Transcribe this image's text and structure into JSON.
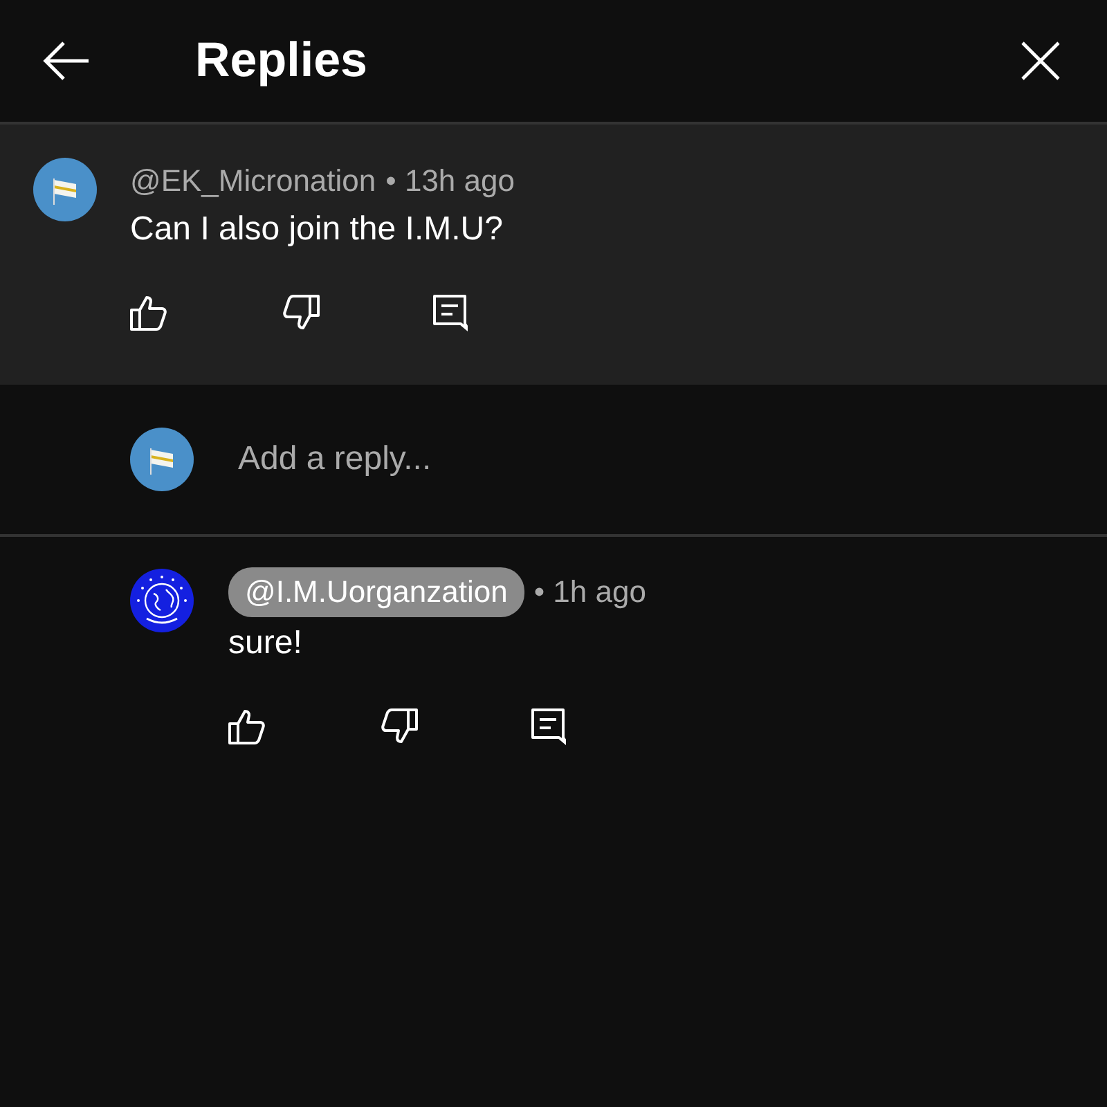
{
  "header": {
    "title": "Replies"
  },
  "parent_comment": {
    "author": "@EK_Micronation",
    "author_highlighted": false,
    "separator": "•",
    "time": "13h ago",
    "text": "Can I also join the I.M.U?",
    "avatar": {
      "kind": "flag"
    }
  },
  "reply_box": {
    "avatar": {
      "kind": "flag"
    },
    "placeholder": "Add a reply..."
  },
  "replies": [
    {
      "author": "@I.M.Uorganzation",
      "author_highlighted": true,
      "separator": "•",
      "time": "1h ago",
      "text": "sure!",
      "avatar": {
        "kind": "globe"
      }
    }
  ]
}
